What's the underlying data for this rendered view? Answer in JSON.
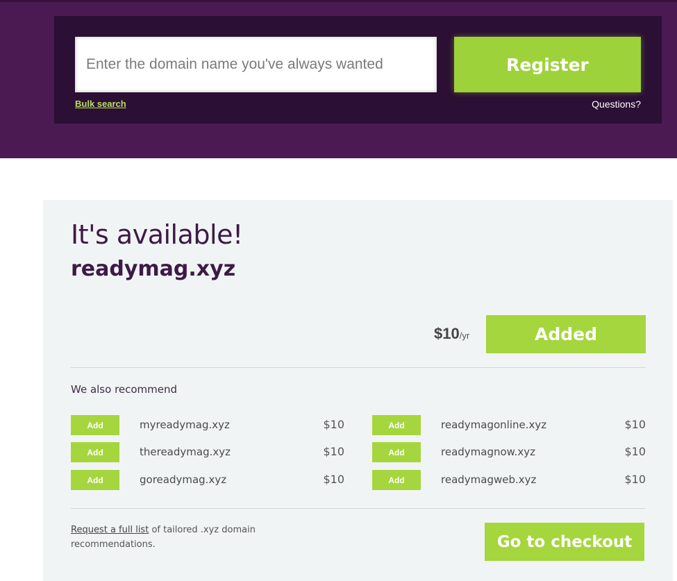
{
  "search": {
    "placeholder": "Enter the domain name you've always wanted",
    "value": "",
    "register_label": "Register",
    "bulk_search_label": "Bulk search",
    "questions_label": "Questions?"
  },
  "result": {
    "status_title": "It's available!",
    "domain": "readymag.xyz",
    "price": "$10",
    "price_unit": "/yr",
    "added_label": "Added"
  },
  "recommendations": {
    "heading": "We also recommend",
    "items": [
      {
        "add_label": "Add",
        "domain": "myreadymag.xyz",
        "price": "$10"
      },
      {
        "add_label": "Add",
        "domain": "readymagonline.xyz",
        "price": "$10"
      },
      {
        "add_label": "Add",
        "domain": "thereadymag.xyz",
        "price": "$10"
      },
      {
        "add_label": "Add",
        "domain": "readymagnow.xyz",
        "price": "$10"
      },
      {
        "add_label": "Add",
        "domain": "goreadymag.xyz",
        "price": "$10"
      },
      {
        "add_label": "Add",
        "domain": "readymagweb.xyz",
        "price": "$10"
      }
    ]
  },
  "footer": {
    "request_link_label": "Request a full list",
    "request_text": " of tailored .xyz domain recommendations.",
    "checkout_label": "Go to checkout"
  },
  "colors": {
    "header_bg": "#4b1a52",
    "panel_bg": "#2c0f34",
    "accent_green": "#a5d63d",
    "title_purple": "#3d1a46",
    "card_bg": "#f1f4f4"
  }
}
